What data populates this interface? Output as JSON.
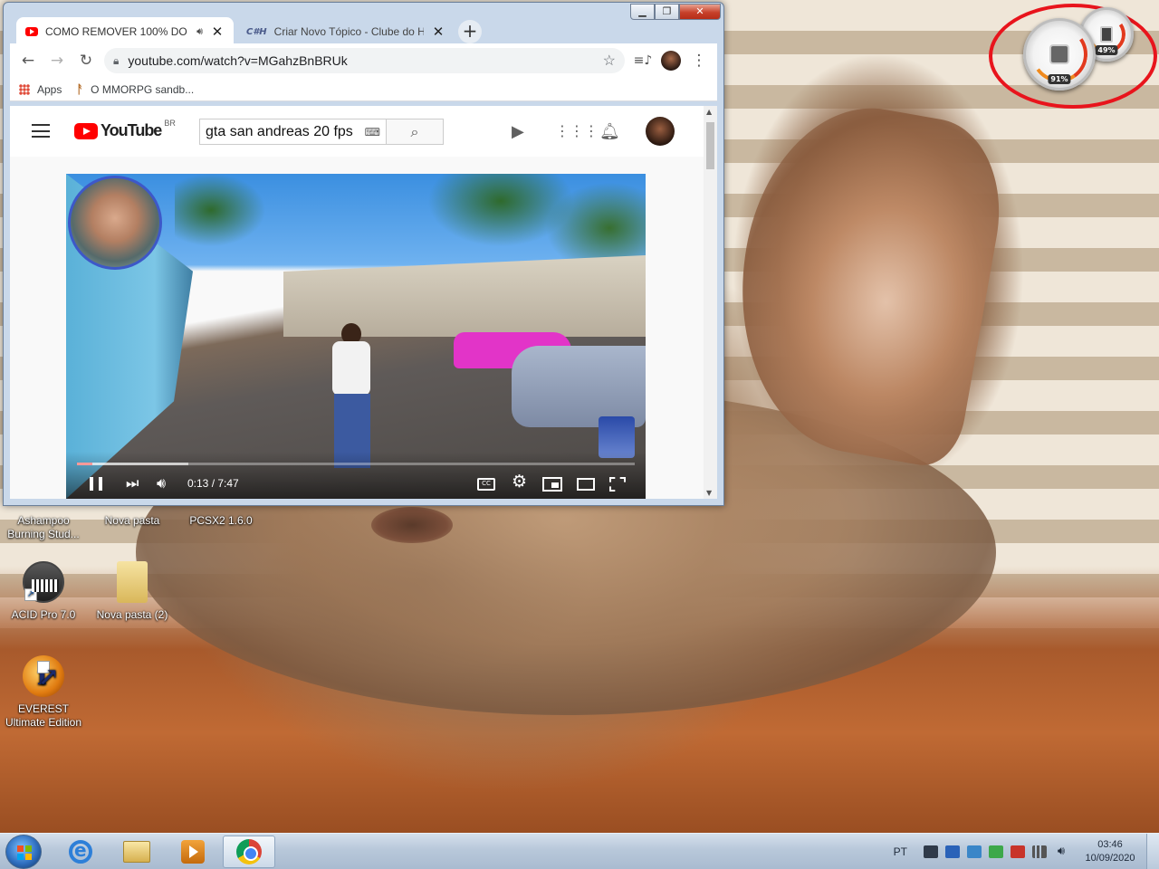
{
  "browser": {
    "tabs": [
      {
        "title": "COMO REMOVER 100% DO",
        "favicon": "youtube-favicon",
        "audio": true
      },
      {
        "title": "Criar Novo Tópico - Clube do Ha",
        "favicon": "clube-favicon"
      }
    ],
    "address": "youtube.com/watch?v=MGahzBnBRUk",
    "bookmarks": [
      {
        "label": "Apps",
        "icon": "apps-grid-icon"
      },
      {
        "label": "O MMORPG sandb...",
        "icon": "mmorpg-favicon"
      }
    ]
  },
  "youtube": {
    "logo_text": "YouTube",
    "region": "BR",
    "search_value": "gta san andreas 20 fps",
    "player": {
      "time": "0:13 / 7:47",
      "progress": 0.028,
      "buffered": 0.2
    }
  },
  "desktop": {
    "icons": [
      {
        "label": "Ashampoo Burning Stud..."
      },
      {
        "label": "Nova pasta"
      },
      {
        "label": "PCSX2 1.6.0"
      },
      {
        "label": "ACID Pro 7.0"
      },
      {
        "label": "Nova pasta (2)"
      },
      {
        "label": "EVEREST Ultimate Edition"
      }
    ]
  },
  "gadget": {
    "cpu_percent": "91%",
    "memory_percent": "49%",
    "highlight_color": "#e8141c"
  },
  "taskbar": {
    "language": "PT",
    "time": "03:46",
    "date": "10/09/2020",
    "apps": [
      "internet-explorer-icon",
      "windows-explorer-icon",
      "media-player-icon",
      "chrome-icon"
    ]
  }
}
